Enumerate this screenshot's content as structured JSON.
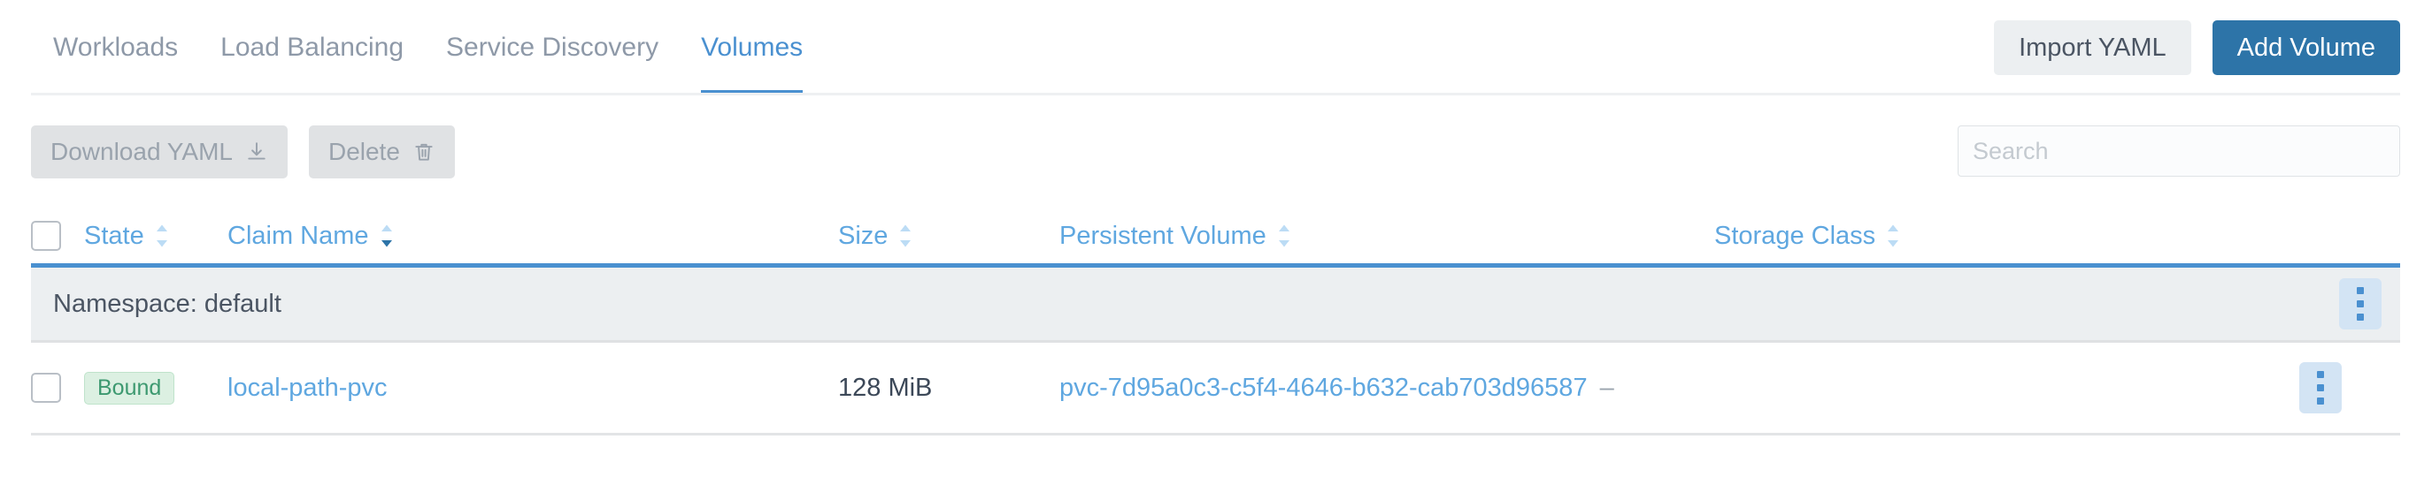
{
  "colors": {
    "accent": "#4a90d0",
    "link": "#5fa7e0",
    "primary_button": "#2d74a8",
    "badge_text": "#3d9970",
    "badge_bg": "#dcf0e2",
    "group_band": "#eceff1"
  },
  "tabs": [
    {
      "label": "Workloads",
      "active": false
    },
    {
      "label": "Load Balancing",
      "active": false
    },
    {
      "label": "Service Discovery",
      "active": false
    },
    {
      "label": "Volumes",
      "active": true
    }
  ],
  "header": {
    "import_yaml_label": "Import YAML",
    "add_volume_label": "Add Volume"
  },
  "toolbar": {
    "download_yaml_label": "Download YAML",
    "download_icon": "download-icon",
    "delete_label": "Delete",
    "delete_icon": "trash-icon",
    "search_placeholder": "Search",
    "search_value": ""
  },
  "table": {
    "columns": [
      {
        "key": "state",
        "label": "State",
        "sortable": true,
        "sort": "none"
      },
      {
        "key": "claim_name",
        "label": "Claim Name",
        "sortable": true,
        "sort": "desc"
      },
      {
        "key": "size",
        "label": "Size",
        "sortable": true,
        "sort": "none"
      },
      {
        "key": "persistent_volume",
        "label": "Persistent Volume",
        "sortable": true,
        "sort": "none"
      },
      {
        "key": "storage_class",
        "label": "Storage Class",
        "sortable": true,
        "sort": "none"
      }
    ],
    "groups": [
      {
        "label": "Namespace: default",
        "rows": [
          {
            "state": "Bound",
            "claim_name": "local-path-pvc",
            "size": "128 MiB",
            "persistent_volume": "pvc-7d95a0c3-c5f4-4646-b632-cab703d96587",
            "storage_class": "–"
          }
        ]
      }
    ]
  }
}
